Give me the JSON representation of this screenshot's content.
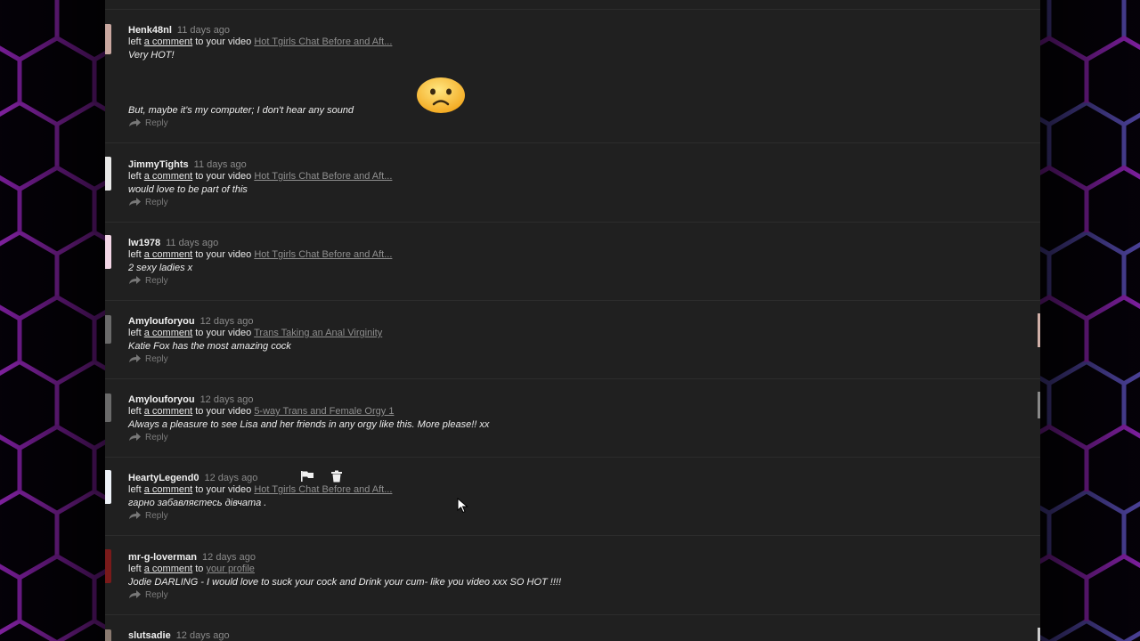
{
  "feed": {
    "reply_label": "Reply",
    "action_phrase": "left",
    "comment_link": "a comment",
    "to_word": "to",
    "items": [
      {
        "user": "Henk48nl",
        "time": "11 days ago",
        "target_prefix": "your video",
        "target_link": "Hot Tgirls Chat Before and Aft...",
        "comment_lines": [
          "Very HOT!",
          "But, maybe it's my computer; I don't hear any sound"
        ]
      },
      {
        "user": "JimmyTights",
        "time": "11 days ago",
        "target_prefix": "your video",
        "target_link": "Hot Tgirls Chat Before and Aft...",
        "comment_lines": [
          "would love to be part of this"
        ]
      },
      {
        "user": "lw1978",
        "time": "11 days ago",
        "target_prefix": "your video",
        "target_link": "Hot Tgirls Chat Before and Aft...",
        "comment_lines": [
          "2 sexy ladies x"
        ]
      },
      {
        "user": "Amylouforyou",
        "time": "12 days ago",
        "target_prefix": "your video",
        "target_link": "Trans Taking an Anal Virginity",
        "comment_lines": [
          "Katie Fox has the most amazing cock"
        ]
      },
      {
        "user": "Amylouforyou",
        "time": "12 days ago",
        "target_prefix": "your video",
        "target_link": "5-way Trans and Female Orgy 1",
        "comment_lines": [
          "Always a pleasure to see Lisa and her friends in any orgy like this. More please!! xx"
        ]
      },
      {
        "user": "HeartyLegend0",
        "time": "12 days ago",
        "target_prefix": "your video",
        "target_link": "Hot Tgirls Chat Before and Aft...",
        "comment_lines": [
          "гарно забавляєтесь дівчата ."
        ]
      },
      {
        "user": "mr-g-loverman",
        "time": "12 days ago",
        "target_prefix": "",
        "target_link": "your profile",
        "comment_lines": [
          "Jodie DARLING - I would love to suck your cock and Drink your cum- like you video xxx SO HOT !!!!"
        ]
      },
      {
        "user": "slutsadie",
        "time": "12 days ago"
      }
    ]
  }
}
